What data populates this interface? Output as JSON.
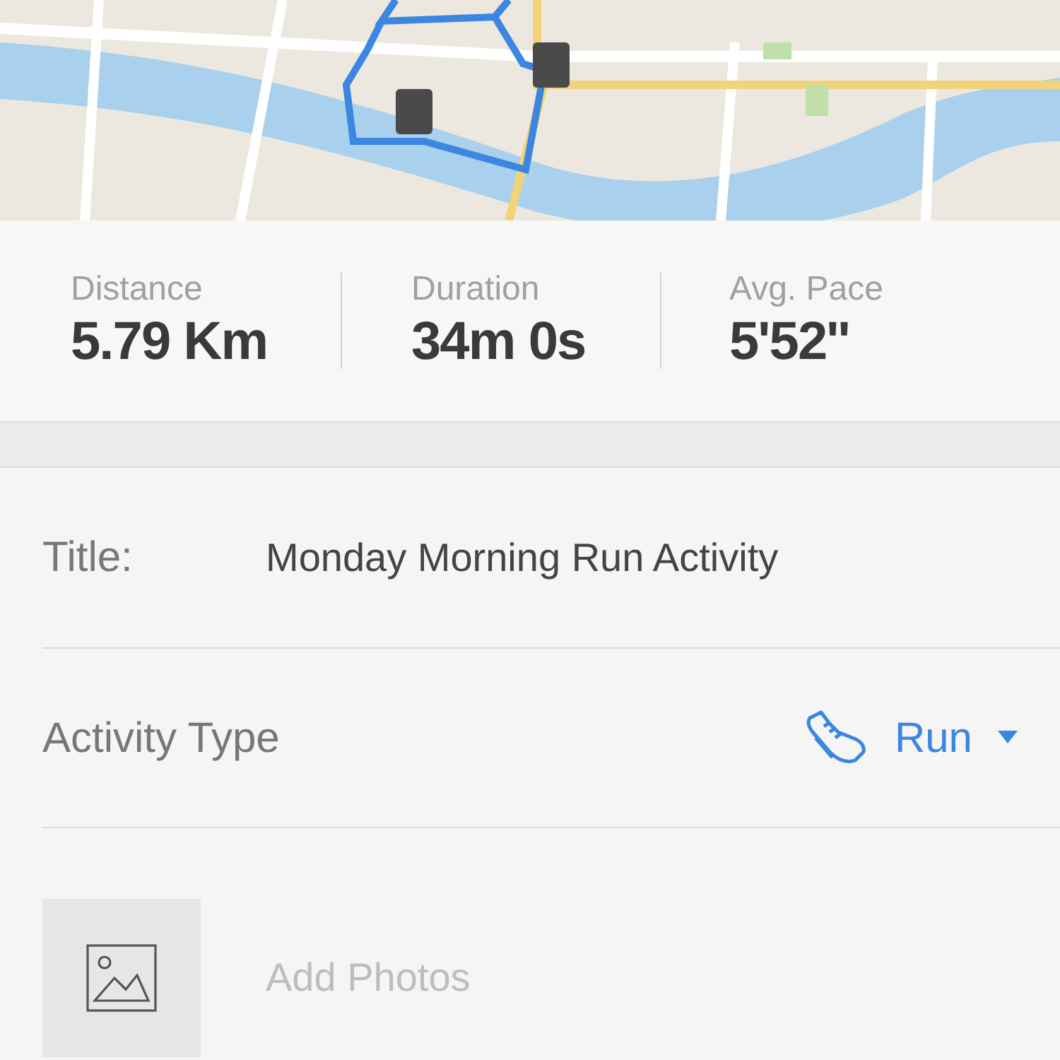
{
  "stats": [
    {
      "label": "Distance",
      "value": "5.79 Km"
    },
    {
      "label": "Duration",
      "value": "34m 0s"
    },
    {
      "label": "Avg. Pace",
      "value": "5'52''"
    }
  ],
  "form": {
    "title": {
      "label": "Title:",
      "value": "Monday Morning Run Activity"
    },
    "activity_type": {
      "label": "Activity Type",
      "value": "Run"
    },
    "photos": {
      "placeholder": "Add Photos"
    }
  }
}
